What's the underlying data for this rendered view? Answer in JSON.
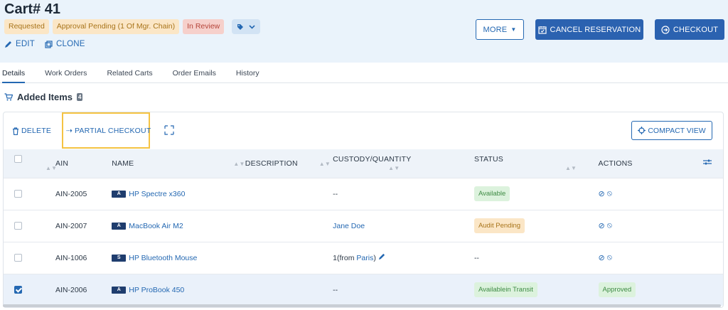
{
  "header": {
    "title": "Cart# 41",
    "badges": {
      "requested": "Requested",
      "approval": "Approval Pending (1 Of Mgr. Chain)",
      "review": "In Review"
    },
    "edit_label": "EDIT",
    "clone_label": "CLONE",
    "more_label": "MORE",
    "cancel_label": "CANCEL RESERVATION",
    "checkout_label": "CHECKOUT"
  },
  "tabs": [
    "Details",
    "Work Orders",
    "Related Carts",
    "Order Emails",
    "History"
  ],
  "section": {
    "title": "Added Items",
    "count": "4"
  },
  "toolbar": {
    "delete_label": "DELETE",
    "partial_label": "PARTIAL CHECKOUT",
    "compact_label": "COMPACT VIEW"
  },
  "table": {
    "columns": {
      "ain": "AIN",
      "name": "NAME",
      "description": "DESCRIPTION",
      "custody": "CUSTODY/QUANTITY",
      "status": "STATUS",
      "actions": "ACTIONS"
    },
    "rows": [
      {
        "ain": "AIN-2005",
        "type": "A",
        "name": "HP Spectre x360",
        "custody": "--",
        "status": "Available",
        "action_status": ""
      },
      {
        "ain": "AIN-2007",
        "type": "A",
        "name": "MacBook Air M2",
        "custody": "Jane Doe",
        "status": "Audit Pending",
        "action_status": ""
      },
      {
        "ain": "AIN-1006",
        "type": "S",
        "name": "HP Bluetooth Mouse",
        "custody_prefix": "1(from ",
        "custody_link": "Paris",
        "custody_suffix": ")",
        "status": "--",
        "action_status": ""
      },
      {
        "ain": "AIN-2006",
        "type": "A",
        "name": "HP ProBook 450",
        "custody": "--",
        "status": "Availablein Transit",
        "action_status": "Approved"
      }
    ]
  },
  "colors": {
    "accent": "#2468b2",
    "header_bg": "#eaf3fb",
    "highlight_border": "#f5c343"
  }
}
